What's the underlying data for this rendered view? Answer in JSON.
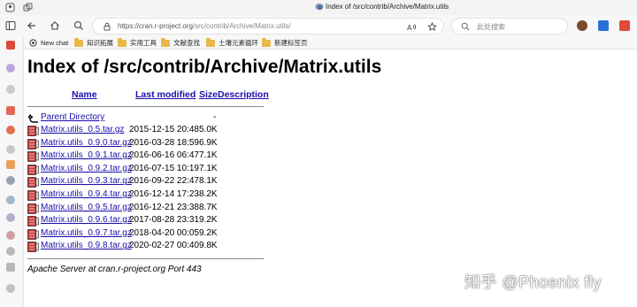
{
  "browser": {
    "tab_title": "Index of /src/contrib/Archive/Matrix.utils",
    "url_host": "https://cran.r-project.org",
    "url_path": "/src/contrib/Archive/Matrix.utils/",
    "search_placeholder": "搜索",
    "search_prefix": "此处",
    "search_full": "此处搜索"
  },
  "bookmarks": [
    {
      "label": "New chat",
      "icon": "chat-icon"
    },
    {
      "label": "知识拓展",
      "icon": "folder-icon"
    },
    {
      "label": "实用工具",
      "icon": "folder-icon"
    },
    {
      "label": "文献查找",
      "icon": "folder-icon"
    },
    {
      "label": "土壤元素循环",
      "icon": "folder-icon"
    },
    {
      "label": "新建标签页",
      "icon": "folder-icon"
    }
  ],
  "page": {
    "title": "Index of /src/contrib/Archive/Matrix.utils",
    "columns": {
      "name": "Name",
      "last_modified": "Last modified",
      "size": "Size",
      "description": "Description"
    },
    "parent": {
      "name": "Parent Directory",
      "size": "-"
    },
    "files": [
      {
        "name": "Matrix.utils_0.5.tar.gz",
        "date": "2015-12-15 20:48",
        "size": "5.0K"
      },
      {
        "name": "Matrix.utils_0.9.0.tar.gz",
        "date": "2016-03-28 18:59",
        "size": "6.9K"
      },
      {
        "name": "Matrix.utils_0.9.1.tar.gz",
        "date": "2016-06-16 06:47",
        "size": "7.1K"
      },
      {
        "name": "Matrix.utils_0.9.2.tar.gz",
        "date": "2016-07-15 10:19",
        "size": "7.1K"
      },
      {
        "name": "Matrix.utils_0.9.3.tar.gz",
        "date": "2016-09-22 22:47",
        "size": "8.1K"
      },
      {
        "name": "Matrix.utils_0.9.4.tar.gz",
        "date": "2016-12-14 17:23",
        "size": "8.2K"
      },
      {
        "name": "Matrix.utils_0.9.5.tar.gz",
        "date": "2016-12-21 23:38",
        "size": "8.7K"
      },
      {
        "name": "Matrix.utils_0.9.6.tar.gz",
        "date": "2017-08-28 23:31",
        "size": "9.2K"
      },
      {
        "name": "Matrix.utils_0.9.7.tar.gz",
        "date": "2018-04-20 00:05",
        "size": "9.2K"
      },
      {
        "name": "Matrix.utils_0.9.8.tar.gz",
        "date": "2020-02-27 00:40",
        "size": "9.8K"
      }
    ],
    "footer": "Apache Server at cran.r-project.org Port 443"
  },
  "watermark": "知乎 @Phoenix fly",
  "colors": {
    "link": "#1a0dab",
    "folder": "#e8b94a",
    "toolbar": "#f7f7f7"
  }
}
